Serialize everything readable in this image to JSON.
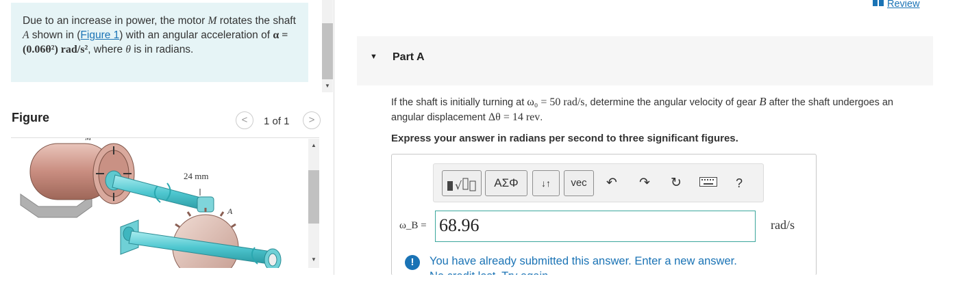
{
  "problem": {
    "text_1": "Due to an increase in power, the motor ",
    "var_M": "M",
    "text_2": " rotates the shaft ",
    "var_A": "A",
    "text_3": " shown in (",
    "figure_link": "Figure 1",
    "text_4": ") with an angular acceleration of ",
    "alpha_expr": "α = (0.06θ²) rad/s²",
    "text_5": ", where ",
    "var_theta": "θ",
    "text_6": " is in radians."
  },
  "figure_panel": {
    "label": "Figure",
    "counter": "1 of 1",
    "prev_icon": "chevron-left-icon",
    "next_icon": "chevron-right-icon",
    "dim_label": "24 mm",
    "motor_label": "M",
    "shaft_label": "A"
  },
  "review": {
    "label": "Review",
    "icon": "book-icon"
  },
  "part": {
    "title": "Part A",
    "question_1": "If the shaft is initially turning at ",
    "omega0": "ω₀ = 50 rad/s",
    "question_2": ", determine the angular velocity of gear ",
    "var_B": "B",
    "question_3": " after the shaft undergoes an angular displacement ",
    "delta_theta": "Δθ = 14 rev",
    "question_4": ".",
    "instruction": "Express your answer in radians per second to three significant figures."
  },
  "toolbar": {
    "templates_icon": "templates-icon",
    "greek": "ΑΣΦ",
    "arrows": "↓↑",
    "vec": "vec",
    "undo_icon": "undo-icon",
    "redo_icon": "redo-icon",
    "reset_icon": "reset-icon",
    "keyboard_icon": "keyboard-icon",
    "help": "?"
  },
  "answer": {
    "label": "ω_B =",
    "value": "68.96",
    "unit": "rad/s"
  },
  "feedback": {
    "message": "You have already submitted this answer. Enter a new answer.",
    "clipped": "No credit lost. Try again."
  },
  "colors": {
    "accent": "#1a73b5",
    "problem_bg": "#e6f4f6",
    "input_border": "#3aa69c"
  }
}
